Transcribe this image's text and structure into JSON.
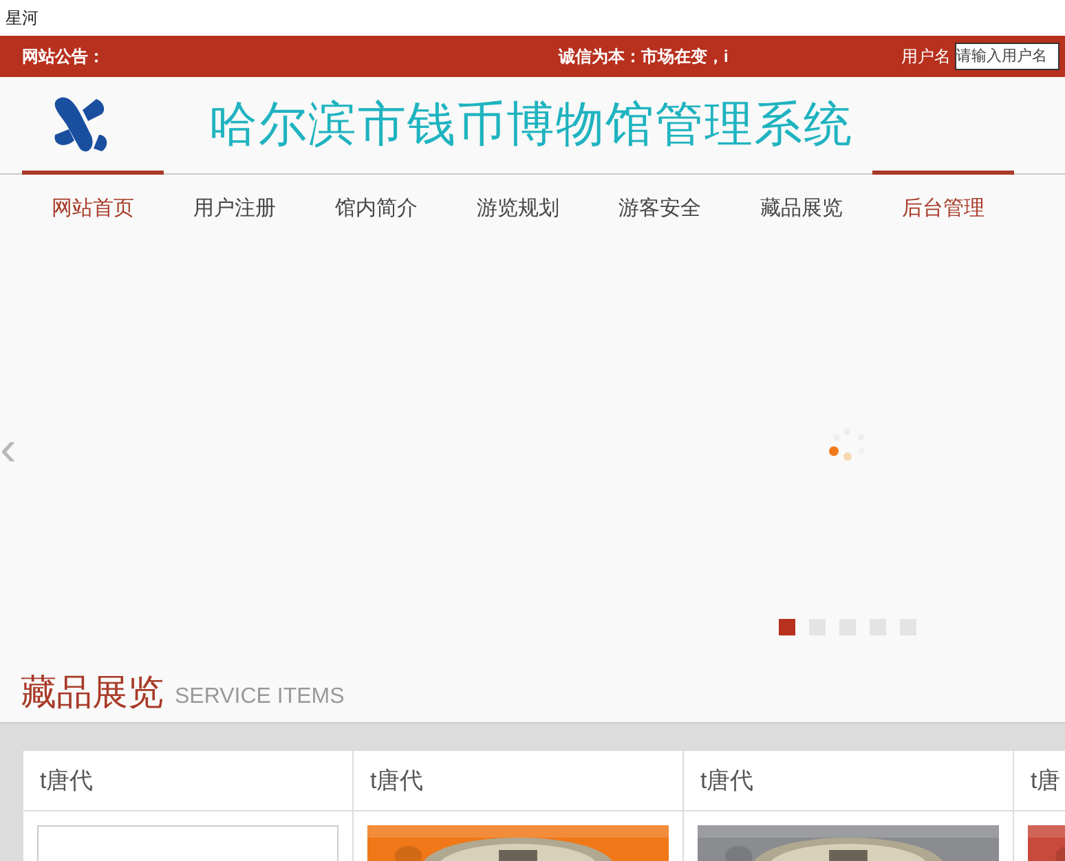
{
  "browser_title": "星河",
  "notice_bar": {
    "label": "网站公告：",
    "message": "诚信为本：市场在变，i",
    "username_label": "用户名",
    "username_field": {
      "placeholder": "请输入用户名"
    }
  },
  "site_title": "哈尔滨市钱币博物馆管理系统",
  "nav": [
    {
      "label": "网站首页",
      "highlighted": true
    },
    {
      "label": "用户注册",
      "highlighted": false
    },
    {
      "label": "馆内简介",
      "highlighted": false
    },
    {
      "label": "游览规划",
      "highlighted": false
    },
    {
      "label": "游客安全",
      "highlighted": false
    },
    {
      "label": "藏品展览",
      "highlighted": false
    },
    {
      "label": "后台管理",
      "highlighted": true
    }
  ],
  "carousel": {
    "prev": "‹",
    "dots": [
      {
        "selected": true
      },
      {
        "selected": false
      },
      {
        "selected": false
      },
      {
        "selected": false
      },
      {
        "selected": false
      }
    ]
  },
  "section": {
    "title": "藏品展览",
    "subtitle": "SERVICE ITEMS"
  },
  "cards": [
    {
      "title": "t唐代",
      "kind": "empty"
    },
    {
      "title": "t唐代",
      "kind": "picture",
      "color": "#f07818"
    },
    {
      "title": "t唐代",
      "kind": "picture",
      "color": "#8a8c90"
    },
    {
      "title": "t唐",
      "kind": "picture",
      "color": "#c84a3a"
    }
  ]
}
